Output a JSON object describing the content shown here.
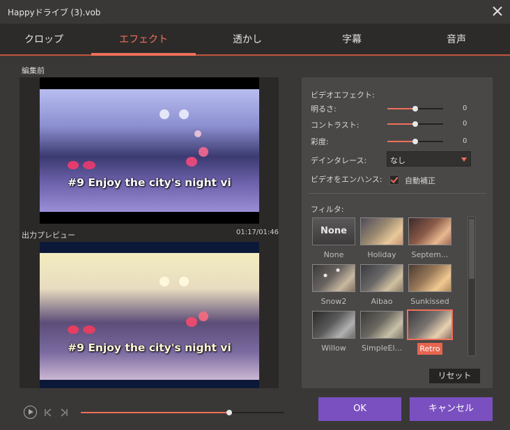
{
  "window": {
    "title": "Happyドライブ (3).vob"
  },
  "tabs": [
    {
      "label": "クロップ"
    },
    {
      "label": "エフェクト",
      "active": true
    },
    {
      "label": "透かし"
    },
    {
      "label": "字幕"
    },
    {
      "label": "音声"
    }
  ],
  "preview": {
    "before_label": "編集前",
    "output_label": "出力プレビュー",
    "timecode": "01:17/01:46",
    "subtitle_text": "#9 Enjoy the city's night vi"
  },
  "effects": {
    "section_label": "ビデオエフェクト:",
    "brightness": {
      "label": "明るさ:",
      "value": "0"
    },
    "contrast": {
      "label": "コントラスト:",
      "value": "0"
    },
    "saturation": {
      "label": "彩度:",
      "value": "0"
    },
    "deinterlace": {
      "label": "デインタレース:",
      "value": "なし"
    },
    "enhance": {
      "label": "ビデオをエンハンス:",
      "checkbox_label": "自動補正",
      "checked": true
    }
  },
  "filters": {
    "label": "フィルタ:",
    "items": [
      {
        "name": "None"
      },
      {
        "name": "Holiday"
      },
      {
        "name": "Septem..."
      },
      {
        "name": "Snow2"
      },
      {
        "name": "Aibao"
      },
      {
        "name": "Sunkissed"
      },
      {
        "name": "Willow"
      },
      {
        "name": "SimpleEl..."
      },
      {
        "name": "Retro",
        "selected": true
      }
    ],
    "none_thumb_text": "None",
    "reset_label": "リセット"
  },
  "buttons": {
    "ok": "OK",
    "cancel": "キャンセル"
  },
  "playback": {
    "progress": 0.73
  },
  "colors": {
    "accent": "#f0705a",
    "button": "#7a50c1",
    "bg": "#3a3837"
  }
}
